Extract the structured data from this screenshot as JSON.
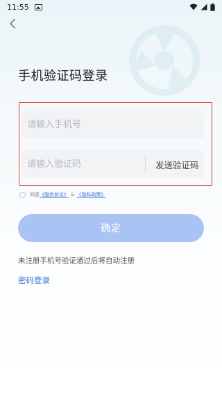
{
  "status_bar": {
    "time": "11:55",
    "icons": [
      "image-notification-icon",
      "wifi-icon",
      "cellular-icon",
      "battery-icon"
    ]
  },
  "header": {
    "back_icon": "chevron-left-icon",
    "title": "手机验证码登录"
  },
  "form": {
    "phone": {
      "value": "",
      "placeholder": "请输入手机号"
    },
    "code": {
      "value": "",
      "placeholder": "请输入验证码"
    },
    "send_code_label": "发送验证码"
  },
  "agreement": {
    "checked": false,
    "prefix": "同意",
    "service_link": "《服务协议》",
    "joiner": "&",
    "privacy_link": "《隐私政策》"
  },
  "confirm_label": "确定",
  "hint": "未注册手机号验证通过后将自动注册",
  "password_login_label": "密码登录",
  "colors": {
    "highlight_border": "#e23a3a",
    "button_bg": "#a8c3f4",
    "link": "#3a6fd8"
  }
}
